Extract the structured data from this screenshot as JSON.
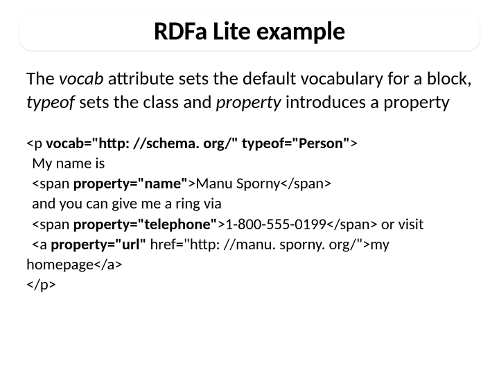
{
  "title": "RDFa Lite example",
  "description": {
    "part1": "The ",
    "em1": "vocab",
    "part2": " attribute sets the default vocabulary for a block, ",
    "em2": "typeof",
    "part3": " sets the class and ",
    "em3": "property",
    "part4": " introduces a property"
  },
  "code": {
    "l1a": "<p ",
    "l1b": "vocab=\"http: //schema. org/\" typeof=\"Person\"",
    "l1c": ">",
    "l2": "My name is",
    "l3a": "<span ",
    "l3b": "property=\"name\"",
    "l3c": ">Manu Sporny</span>",
    "l4": "and you can give me a ring via",
    "l5a": "<span ",
    "l5b": "property=\"telephone\"",
    "l5c": ">1-800-555-0199</span> or visit",
    "l6a": "<a ",
    "l6b": "property=\"url\" ",
    "l6c": "href=\"http: //manu. sporny. org/\">my",
    "l7": "homepage</a>",
    "l8": "</p>"
  }
}
